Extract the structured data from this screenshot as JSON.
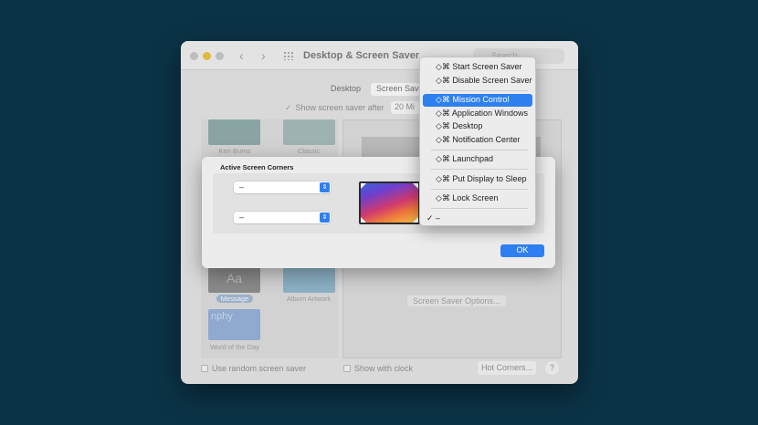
{
  "window": {
    "title": "Desktop & Screen Saver",
    "search_placeholder": "Search",
    "tabs": [
      {
        "label": "Desktop"
      },
      {
        "label": "Screen Saver"
      }
    ],
    "show_screen_saver_after": "Show screen saver after",
    "show_after_value": "20 Mi",
    "savers": [
      {
        "label": "Ken Burns"
      },
      {
        "label": "Classic"
      },
      {
        "label": "Message"
      },
      {
        "label": "Album Artwork"
      },
      {
        "label": "Word of the Day"
      }
    ],
    "message_thumb_text": "Aa",
    "word_thumb_text": "nphy",
    "screen_saver_options": "Screen Saver Options...",
    "use_random": "Use random screen saver",
    "show_with_clock": "Show with clock",
    "hot_corners": "Hot Corners...",
    "help": "?"
  },
  "sheet": {
    "title": "Active Screen Corners",
    "top_left_value": "–",
    "bottom_left_value": "–",
    "ok_label": "OK"
  },
  "menu": {
    "items": [
      {
        "label": "◇⌘ Start Screen Saver"
      },
      {
        "label": "◇⌘ Disable Screen Saver"
      },
      {
        "label": "◇⌘ Mission Control"
      },
      {
        "label": "◇⌘ Application Windows"
      },
      {
        "label": "◇⌘ Desktop"
      },
      {
        "label": "◇⌘ Notification Center"
      },
      {
        "label": "◇⌘ Launchpad"
      },
      {
        "label": "◇⌘ Put Display to Sleep"
      },
      {
        "label": "◇⌘ Lock Screen"
      },
      {
        "label": "–"
      }
    ],
    "highlighted_index": 2,
    "checked_index": 9,
    "checkmark": "✓",
    "highlight_color": "#2f80ef"
  }
}
